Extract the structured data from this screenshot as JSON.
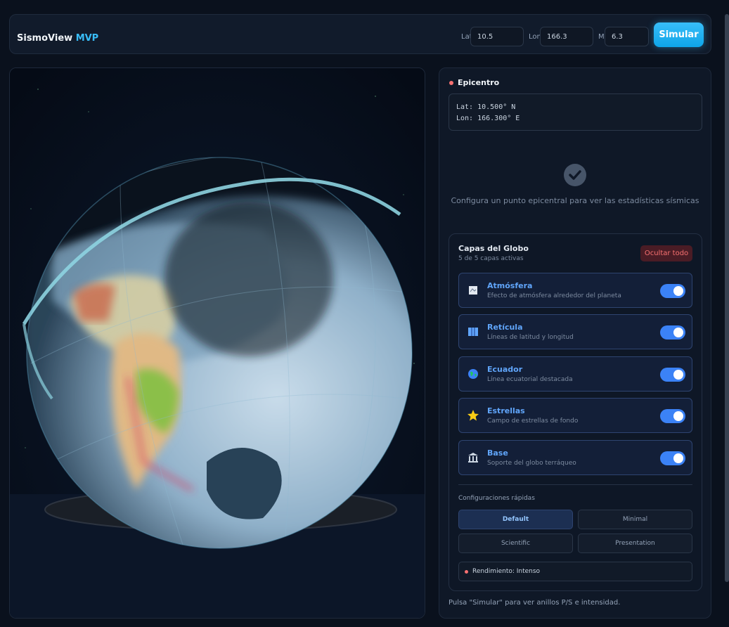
{
  "header": {
    "brand_main": "SismoView",
    "brand_accent": "MVP",
    "lat_label": "Lat",
    "lat_value": "10.5",
    "lon_label": "Lon",
    "lon_value": "166.3",
    "mag_label": "M",
    "mag_value": "6.3",
    "simulate_label": "Simular"
  },
  "epicenter": {
    "title": "Epicentro",
    "lat_text": "Lat: 10.500° N",
    "lon_text": "Lon: 166.300° E"
  },
  "stats_hint": "Configura un punto epicentral para ver las estadísticas sísmicas",
  "layers": {
    "title": "Capas del Globo",
    "subtitle": "5 de 5 capas activas",
    "hide_all_label": "Ocultar todo",
    "items": [
      {
        "name": "Atmósfera",
        "desc": "Efecto de atmósfera alrededor del planeta",
        "icon": "atmosphere-icon",
        "on": true
      },
      {
        "name": "Retícula",
        "desc": "Líneas de latitud y longitud",
        "icon": "map-icon",
        "on": true
      },
      {
        "name": "Ecuador",
        "desc": "Línea ecuatorial destacada",
        "icon": "globe-icon",
        "on": true
      },
      {
        "name": "Estrellas",
        "desc": "Campo de estrellas de fondo",
        "icon": "star-icon",
        "on": true
      },
      {
        "name": "Base",
        "desc": "Soporte del globo terráqueo",
        "icon": "museum-icon",
        "on": true
      }
    ]
  },
  "quick_configs": {
    "title": "Configuraciones rápidas",
    "options": [
      "Default",
      "Minimal",
      "Scientific",
      "Presentation"
    ],
    "selected": "Default"
  },
  "performance": {
    "label": "Rendimiento: Intenso",
    "color": "#f87171"
  },
  "footer_hint": "Pulsa \"Simular\" para ver anillos P/S e intensidad.",
  "colors": {
    "accent": "#38bdf8",
    "toggle_on": "#3b82f6",
    "danger": "#f87171"
  }
}
